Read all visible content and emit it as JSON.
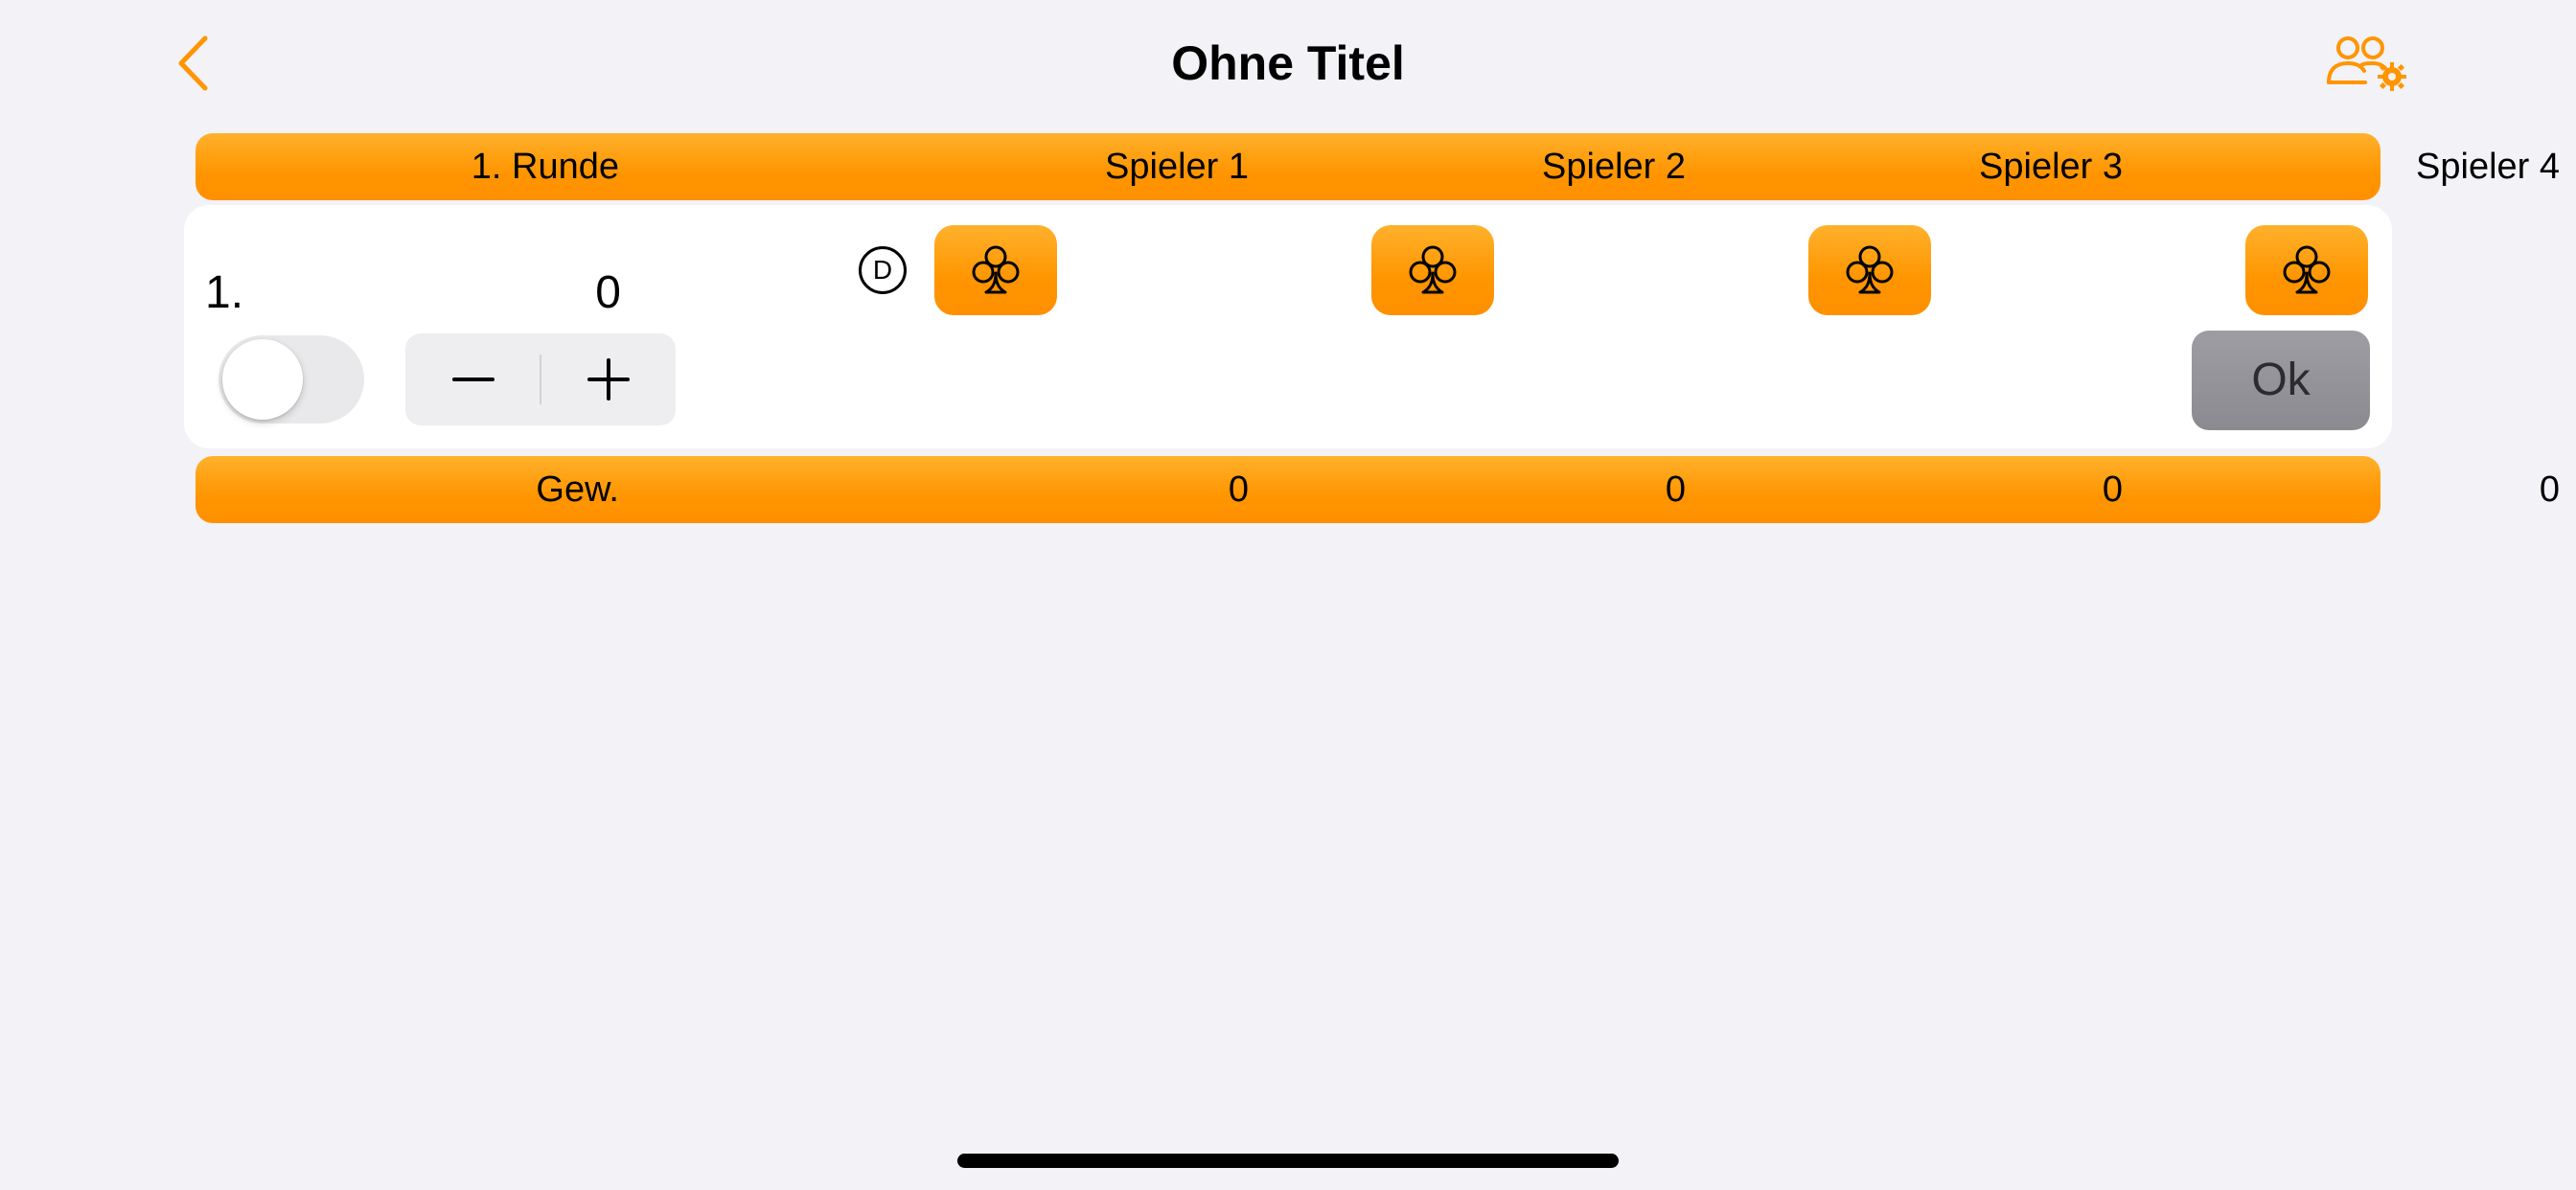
{
  "nav": {
    "title": "Ohne Titel",
    "back_icon": "chevron-left-icon",
    "players_icon": "players-settings-icon"
  },
  "header": {
    "round_label": "1. Runde",
    "players": [
      "Spieler 1",
      "Spieler 2",
      "Spieler 3",
      "Spieler 4"
    ]
  },
  "round": {
    "number": "1.",
    "score": "0",
    "dealer_marker": "D",
    "suit_icon": "club-suit-icon",
    "toggle_on": false,
    "stepper_minus": "minus-icon",
    "stepper_plus": "plus-icon",
    "ok_label": "Ok"
  },
  "totals": {
    "label": "Gew.",
    "values": [
      "0",
      "0",
      "0",
      "0"
    ]
  },
  "colors": {
    "accent": "#ff9500",
    "background": "#f2f2f7",
    "ok_button": "#8e8e93"
  }
}
